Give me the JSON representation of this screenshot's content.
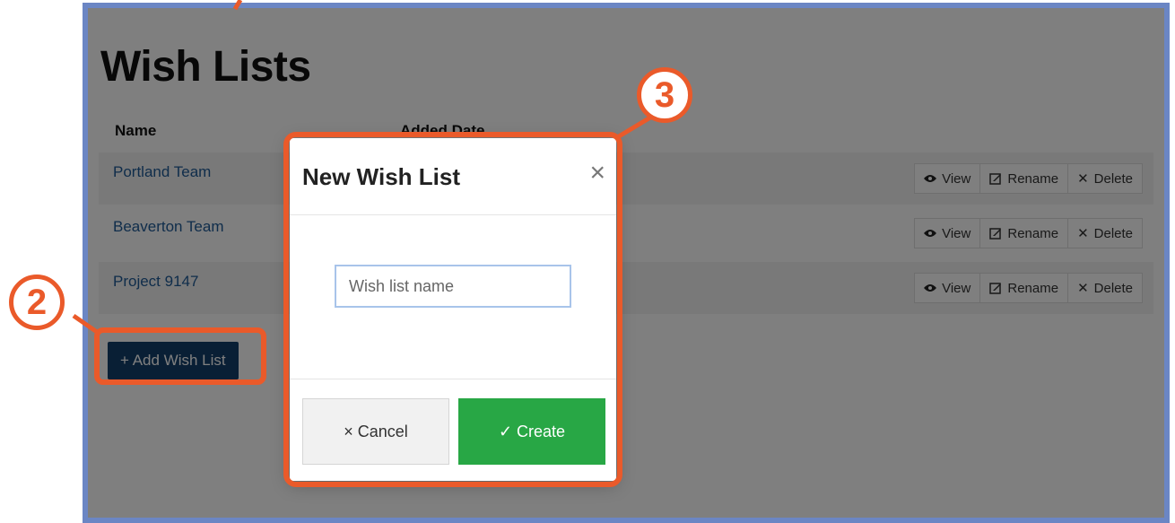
{
  "page": {
    "title": "Wish Lists",
    "columns": [
      "Name",
      "Added Date"
    ],
    "rows": [
      {
        "name": "Portland Team"
      },
      {
        "name": "Beaverton Team"
      },
      {
        "name": "Project 9147"
      }
    ],
    "row_actions": {
      "view": "View",
      "rename": "Rename",
      "delete": "Delete"
    },
    "add_button": "+ Add Wish List"
  },
  "modal": {
    "title": "New Wish List",
    "close_glyph": "×",
    "input_placeholder": "Wish list name",
    "cancel_label": "× Cancel",
    "create_label": "✓ Create"
  },
  "annotations": {
    "badge_2": "2",
    "badge_3": "3",
    "highlight_color": "#ea5a2a"
  },
  "icons": {
    "view": "eye-icon",
    "rename": "edit-icon",
    "delete": "close-icon"
  }
}
